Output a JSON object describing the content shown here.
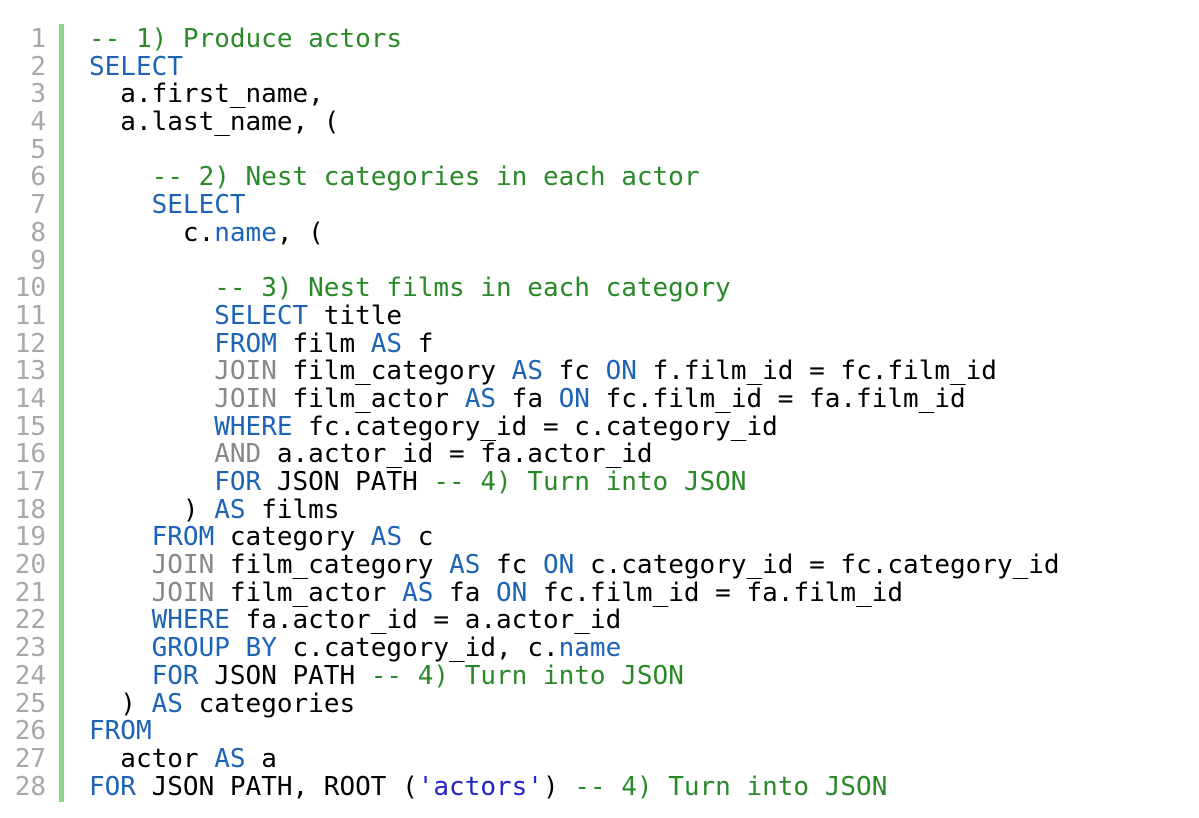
{
  "editor": {
    "lines": [
      {
        "n": "1",
        "tokens": [
          {
            "t": "-- 1) Produce actors",
            "c": "cm"
          }
        ]
      },
      {
        "n": "2",
        "tokens": [
          {
            "t": "SELECT",
            "c": "kw"
          }
        ]
      },
      {
        "n": "3",
        "tokens": [
          {
            "t": "  a.first_name,",
            "c": "plain"
          }
        ]
      },
      {
        "n": "4",
        "tokens": [
          {
            "t": "  a.last_name, (",
            "c": "plain"
          }
        ]
      },
      {
        "n": "5",
        "tokens": []
      },
      {
        "n": "6",
        "tokens": [
          {
            "t": "    ",
            "c": "plain"
          },
          {
            "t": "-- 2) Nest categories in each actor",
            "c": "cm"
          }
        ]
      },
      {
        "n": "7",
        "tokens": [
          {
            "t": "    ",
            "c": "plain"
          },
          {
            "t": "SELECT",
            "c": "kw"
          }
        ]
      },
      {
        "n": "8",
        "tokens": [
          {
            "t": "      c.",
            "c": "plain"
          },
          {
            "t": "name",
            "c": "fn"
          },
          {
            "t": ", (",
            "c": "plain"
          }
        ]
      },
      {
        "n": "9",
        "tokens": []
      },
      {
        "n": "10",
        "tokens": [
          {
            "t": "        ",
            "c": "plain"
          },
          {
            "t": "-- 3) Nest films in each category",
            "c": "cm"
          }
        ]
      },
      {
        "n": "11",
        "tokens": [
          {
            "t": "        ",
            "c": "plain"
          },
          {
            "t": "SELECT",
            "c": "kw"
          },
          {
            "t": " title",
            "c": "plain"
          }
        ]
      },
      {
        "n": "12",
        "tokens": [
          {
            "t": "        ",
            "c": "plain"
          },
          {
            "t": "FROM",
            "c": "kw"
          },
          {
            "t": " film ",
            "c": "plain"
          },
          {
            "t": "AS",
            "c": "kw"
          },
          {
            "t": " f",
            "c": "plain"
          }
        ]
      },
      {
        "n": "13",
        "tokens": [
          {
            "t": "        ",
            "c": "plain"
          },
          {
            "t": "JOIN",
            "c": "kw2"
          },
          {
            "t": " film_category ",
            "c": "plain"
          },
          {
            "t": "AS",
            "c": "kw"
          },
          {
            "t": " fc ",
            "c": "plain"
          },
          {
            "t": "ON",
            "c": "kw"
          },
          {
            "t": " f.film_id = fc.film_id",
            "c": "plain"
          }
        ]
      },
      {
        "n": "14",
        "tokens": [
          {
            "t": "        ",
            "c": "plain"
          },
          {
            "t": "JOIN",
            "c": "kw2"
          },
          {
            "t": " film_actor ",
            "c": "plain"
          },
          {
            "t": "AS",
            "c": "kw"
          },
          {
            "t": " fa ",
            "c": "plain"
          },
          {
            "t": "ON",
            "c": "kw"
          },
          {
            "t": " fc.film_id = fa.film_id",
            "c": "plain"
          }
        ]
      },
      {
        "n": "15",
        "tokens": [
          {
            "t": "        ",
            "c": "plain"
          },
          {
            "t": "WHERE",
            "c": "kw"
          },
          {
            "t": " fc.category_id = c.category_id",
            "c": "plain"
          }
        ]
      },
      {
        "n": "16",
        "tokens": [
          {
            "t": "        ",
            "c": "plain"
          },
          {
            "t": "AND",
            "c": "kw2"
          },
          {
            "t": " a.actor_id = fa.actor_id",
            "c": "plain"
          }
        ]
      },
      {
        "n": "17",
        "tokens": [
          {
            "t": "        ",
            "c": "plain"
          },
          {
            "t": "FOR",
            "c": "kw"
          },
          {
            "t": " JSON PATH ",
            "c": "plain"
          },
          {
            "t": "-- 4) Turn into JSON",
            "c": "cm"
          }
        ]
      },
      {
        "n": "18",
        "tokens": [
          {
            "t": "      ) ",
            "c": "plain"
          },
          {
            "t": "AS",
            "c": "kw"
          },
          {
            "t": " films",
            "c": "plain"
          }
        ]
      },
      {
        "n": "19",
        "tokens": [
          {
            "t": "    ",
            "c": "plain"
          },
          {
            "t": "FROM",
            "c": "kw"
          },
          {
            "t": " category ",
            "c": "plain"
          },
          {
            "t": "AS",
            "c": "kw"
          },
          {
            "t": " c",
            "c": "plain"
          }
        ]
      },
      {
        "n": "20",
        "tokens": [
          {
            "t": "    ",
            "c": "plain"
          },
          {
            "t": "JOIN",
            "c": "kw2"
          },
          {
            "t": " film_category ",
            "c": "plain"
          },
          {
            "t": "AS",
            "c": "kw"
          },
          {
            "t": " fc ",
            "c": "plain"
          },
          {
            "t": "ON",
            "c": "kw"
          },
          {
            "t": " c.category_id = fc.category_id",
            "c": "plain"
          }
        ]
      },
      {
        "n": "21",
        "tokens": [
          {
            "t": "    ",
            "c": "plain"
          },
          {
            "t": "JOIN",
            "c": "kw2"
          },
          {
            "t": " film_actor ",
            "c": "plain"
          },
          {
            "t": "AS",
            "c": "kw"
          },
          {
            "t": " fa ",
            "c": "plain"
          },
          {
            "t": "ON",
            "c": "kw"
          },
          {
            "t": " fc.film_id = fa.film_id",
            "c": "plain"
          }
        ]
      },
      {
        "n": "22",
        "tokens": [
          {
            "t": "    ",
            "c": "plain"
          },
          {
            "t": "WHERE",
            "c": "kw"
          },
          {
            "t": " fa.actor_id = a.actor_id",
            "c": "plain"
          }
        ]
      },
      {
        "n": "23",
        "tokens": [
          {
            "t": "    ",
            "c": "plain"
          },
          {
            "t": "GROUP BY",
            "c": "kw"
          },
          {
            "t": " c.category_id, c.",
            "c": "plain"
          },
          {
            "t": "name",
            "c": "fn"
          }
        ]
      },
      {
        "n": "24",
        "tokens": [
          {
            "t": "    ",
            "c": "plain"
          },
          {
            "t": "FOR",
            "c": "kw"
          },
          {
            "t": " JSON PATH ",
            "c": "plain"
          },
          {
            "t": "-- 4) Turn into JSON",
            "c": "cm"
          }
        ]
      },
      {
        "n": "25",
        "tokens": [
          {
            "t": "  ) ",
            "c": "plain"
          },
          {
            "t": "AS",
            "c": "kw"
          },
          {
            "t": " categories",
            "c": "plain"
          }
        ]
      },
      {
        "n": "26",
        "tokens": [
          {
            "t": "FROM",
            "c": "kw"
          }
        ]
      },
      {
        "n": "27",
        "tokens": [
          {
            "t": "  actor ",
            "c": "plain"
          },
          {
            "t": "AS",
            "c": "kw"
          },
          {
            "t": " a",
            "c": "plain"
          }
        ]
      },
      {
        "n": "28",
        "tokens": [
          {
            "t": "FOR",
            "c": "kw"
          },
          {
            "t": " JSON PATH, ROOT (",
            "c": "plain"
          },
          {
            "t": "'actors'",
            "c": "str"
          },
          {
            "t": ") ",
            "c": "plain"
          },
          {
            "t": "-- 4) Turn into JSON",
            "c": "cm"
          }
        ]
      }
    ]
  },
  "colors": {
    "keyword": "#1d64b6",
    "keyword_dim": "#888888",
    "comment": "#2a8a2a",
    "string": "#2424c8",
    "gutter_bar": "#8fd68a",
    "line_number": "#a8a8a8"
  }
}
